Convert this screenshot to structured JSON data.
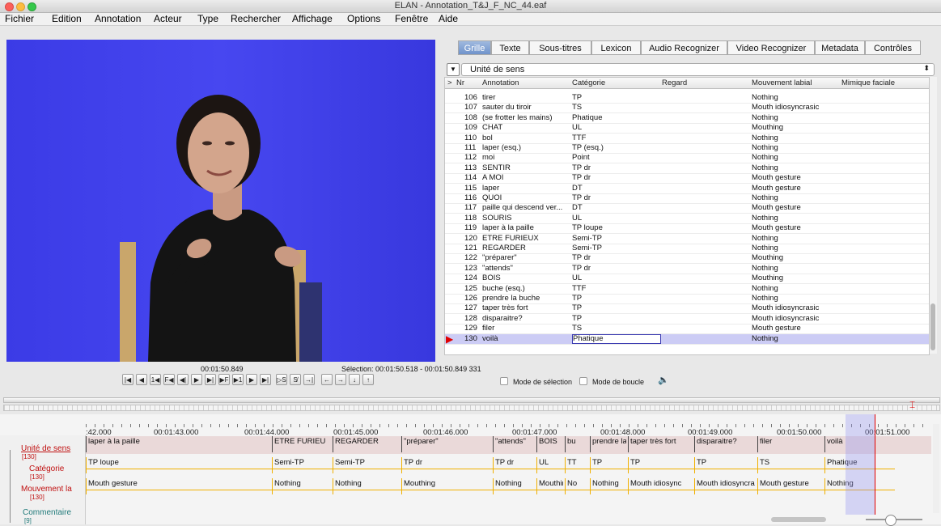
{
  "window": {
    "title": "ELAN - Annotation_T&J_F_NC_44.eaf"
  },
  "menu": [
    "Fichier",
    "Edition",
    "Annotation",
    "Acteur",
    "Type",
    "Rechercher",
    "Affichage",
    "Options",
    "Fenêtre",
    "Aide"
  ],
  "tabs": [
    "Grille",
    "Texte",
    "Sous-titres",
    "Lexicon",
    "Audio Recognizer",
    "Video Recognizer",
    "Metadata",
    "Contrôles"
  ],
  "active_tab": "Grille",
  "tier_selector": {
    "value": "Unité de sens"
  },
  "grid": {
    "headers": [
      ">",
      "Nr",
      "Annotation",
      "Catégorie",
      "Regard",
      "Mouvement labial",
      "Mimique faciale"
    ],
    "rows": [
      [
        "106",
        "tirer",
        "TP",
        "",
        "Nothing"
      ],
      [
        "107",
        "sauter du tiroir",
        "TS",
        "",
        "Mouth idiosyncrasic"
      ],
      [
        "108",
        "(se frotter les mains)",
        "Phatique",
        "",
        "Nothing"
      ],
      [
        "109",
        "CHAT",
        "UL",
        "",
        "Mouthing"
      ],
      [
        "110",
        "bol",
        "TTF",
        "",
        "Nothing"
      ],
      [
        "111",
        "laper (esq.)",
        "TP (esq.)",
        "",
        "Nothing"
      ],
      [
        "112",
        "moi",
        "Point",
        "",
        "Nothing"
      ],
      [
        "113",
        "SENTIR",
        "TP dr",
        "",
        "Nothing"
      ],
      [
        "114",
        "A MOI",
        "TP dr",
        "",
        "Mouth gesture"
      ],
      [
        "115",
        "laper",
        "DT",
        "",
        "Mouth gesture"
      ],
      [
        "116",
        "QUOI",
        "TP dr",
        "",
        "Nothing"
      ],
      [
        "117",
        "paille qui descend ver...",
        "DT",
        "",
        "Mouth gesture"
      ],
      [
        "118",
        "SOURIS",
        "UL",
        "",
        "Nothing"
      ],
      [
        "119",
        "laper à la paille",
        "TP loupe",
        "",
        "Mouth gesture"
      ],
      [
        "120",
        "ETRE FURIEUX",
        "Semi-TP",
        "",
        "Nothing"
      ],
      [
        "121",
        "REGARDER",
        "Semi-TP",
        "",
        "Nothing"
      ],
      [
        "122",
        "\"préparer\"",
        "TP dr",
        "",
        "Mouthing"
      ],
      [
        "123",
        "\"attends\"",
        "TP dr",
        "",
        "Nothing"
      ],
      [
        "124",
        "BOIS",
        "UL",
        "",
        "Mouthing"
      ],
      [
        "125",
        "buche (esq.)",
        "TTF",
        "",
        "Nothing"
      ],
      [
        "126",
        "prendre la buche",
        "TP",
        "",
        "Nothing"
      ],
      [
        "127",
        "taper très fort",
        "TP",
        "",
        "Mouth idiosyncrasic"
      ],
      [
        "128",
        "disparaitre?",
        "TP",
        "",
        "Mouth idiosyncrasic"
      ],
      [
        "129",
        "filer",
        "TS",
        "",
        "Mouth gesture"
      ],
      [
        "130",
        "voilà",
        "Phatique",
        "",
        "Nothing"
      ]
    ],
    "selected_row": 130
  },
  "player": {
    "current_time": "00:01:50.849",
    "selection": "Sélection: 00:01:50.518 - 00:01:50.849  331",
    "selection_mode_label": "Mode de sélection",
    "loop_mode_label": "Mode de boucle"
  },
  "timeline": {
    "ticks": [
      ":42.000",
      "00:01:43.000",
      "00:01:44.000",
      "00:01:45.000",
      "00:01:46.000",
      "00:01:47.000",
      "00:01:48.000",
      "00:01:49.000",
      "00:01:50.000",
      "00:01:51.000"
    ],
    "tiers": [
      {
        "name": "Unité de sens",
        "count": "[130]",
        "annotations": [
          "laper à la paille",
          "ETRE FURIEU",
          "REGARDER",
          "\"préparer\"",
          "\"attends\"",
          "BOIS",
          "bu",
          "prendre la",
          "taper très fort",
          "disparaitre?",
          "filer",
          "voilà"
        ]
      },
      {
        "name": "Catégorie",
        "count": "[130]",
        "annotations": [
          "TP loupe",
          "Semi-TP",
          "Semi-TP",
          "TP dr",
          "TP dr",
          "UL",
          "TT",
          "TP",
          "TP",
          "TP",
          "TS",
          "Phatique"
        ]
      },
      {
        "name": "Mouvement la",
        "count": "[130]",
        "annotations": [
          "Mouth gesture",
          "Nothing",
          "Nothing",
          "Mouthing",
          "Nothing",
          "Mouthin",
          "No",
          "Nothing",
          "Mouth idiosync",
          "Mouth idiosyncra",
          "Mouth gesture",
          "Nothing"
        ]
      },
      {
        "name": "Commentaire",
        "count": "[9]",
        "annotations": []
      }
    ]
  },
  "colors": {
    "video_bg": "#4040ea",
    "tier_label": "#c01010",
    "selection_row": "#ccccf5",
    "cursor": "#e00000",
    "annot_line": "#f0b000"
  }
}
